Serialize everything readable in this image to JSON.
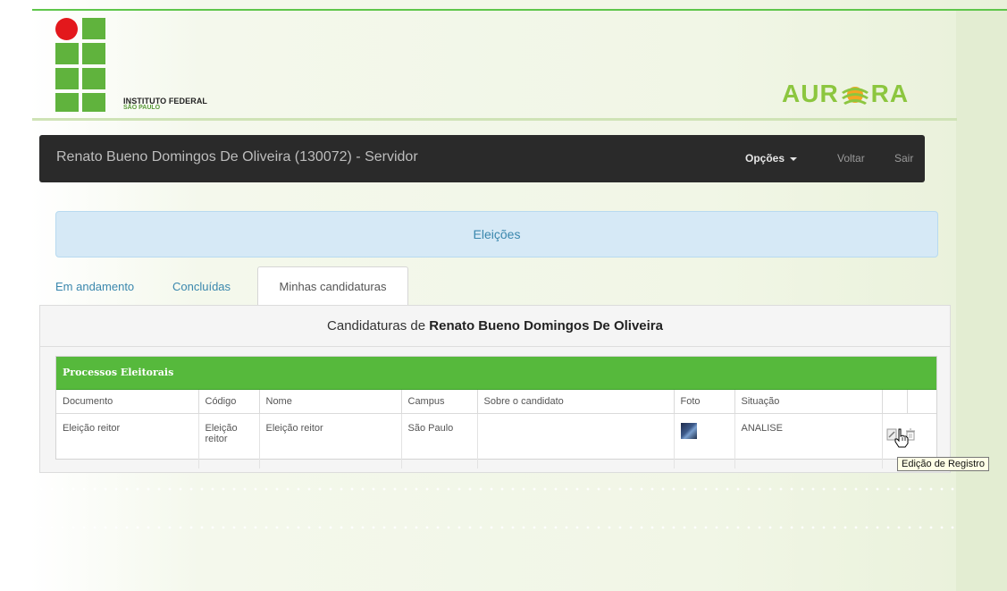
{
  "header": {
    "logo_title": "INSTITUTO FEDERAL",
    "logo_subtitle": "SÃO PAULO",
    "brand_left": "AUR",
    "brand_right": "RA"
  },
  "navbar": {
    "user": "Renato Bueno Domingos De Oliveira (130072) - Servidor",
    "options_label": "Opções",
    "back_label": "Voltar",
    "exit_label": "Sair"
  },
  "alert": {
    "text": "Eleições"
  },
  "tabs": [
    {
      "label": "Em andamento"
    },
    {
      "label": "Concluídas"
    },
    {
      "label": "Minhas candidaturas"
    }
  ],
  "panel": {
    "title_prefix": "Candidaturas de",
    "title_name": "Renato Bueno Domingos De Oliveira"
  },
  "grid": {
    "title": "Processos Eleitorais",
    "columns": [
      "Documento",
      "Código",
      "Nome",
      "Campus",
      "Sobre o candidato",
      "Foto",
      "Situação"
    ],
    "rows": [
      {
        "documento": "Eleição reitor",
        "codigo": "Eleição reitor",
        "nome": "Eleição reitor",
        "campus": "São Paulo",
        "sobre": "",
        "situacao": "ANALISE"
      }
    ]
  },
  "tooltip": {
    "text": "Edição de Registro"
  },
  "colors": {
    "brand_green": "#60b33d",
    "grid_header": "#56b93c",
    "navbar": "#2a2a2a",
    "alert_bg": "#d6e9f6",
    "link": "#3a87ad"
  },
  "icons": [
    "edit-icon",
    "trash-icon",
    "hand-cursor-icon",
    "sun-icon"
  ]
}
